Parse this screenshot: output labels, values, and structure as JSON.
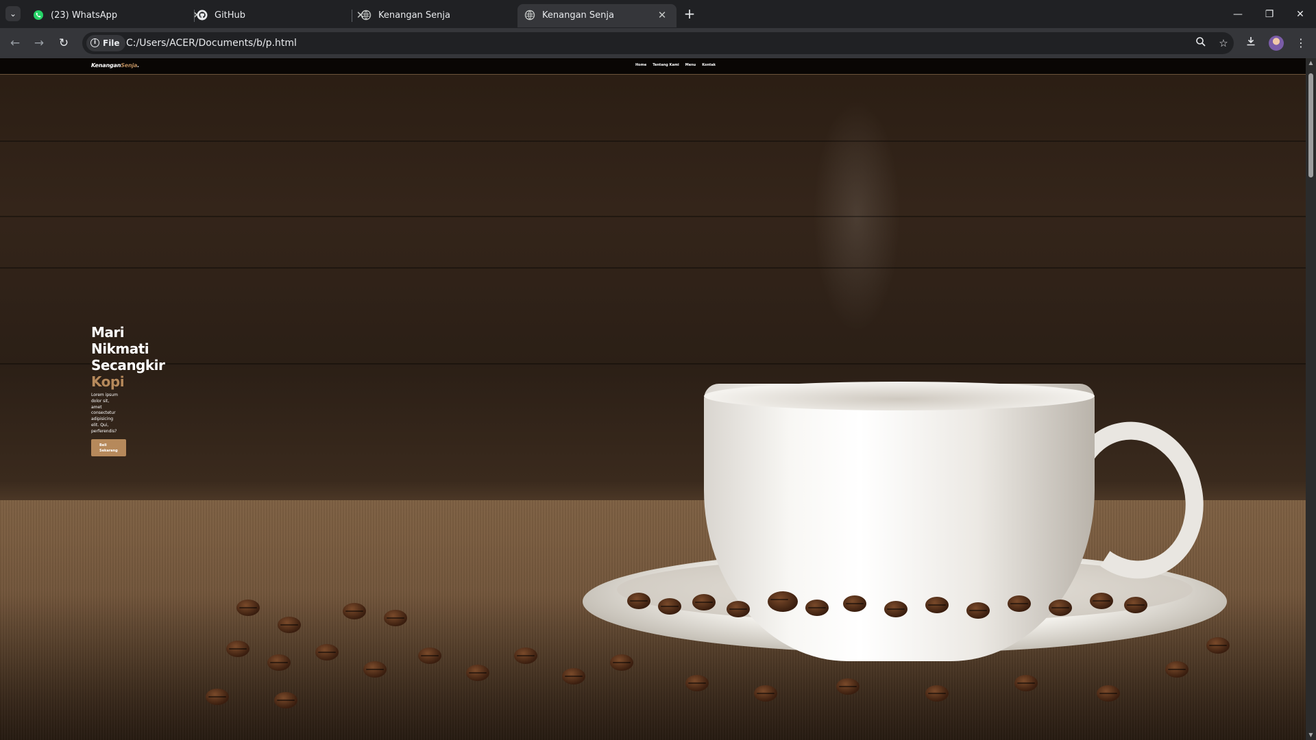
{
  "browser": {
    "tabs": [
      {
        "title": "(23) WhatsApp",
        "icon": "whatsapp-icon",
        "active": false
      },
      {
        "title": "GitHub",
        "icon": "github-icon",
        "active": false
      },
      {
        "title": "Kenangan Senja",
        "icon": "globe-icon",
        "active": false
      },
      {
        "title": "Kenangan Senja",
        "icon": "globe-icon",
        "active": true
      }
    ],
    "new_tab_label": "+",
    "address": {
      "scheme_chip": "File",
      "url": "C:/Users/ACER/Documents/b/p.html"
    },
    "colors": {
      "frame": "#202124",
      "toolbar": "#35363a",
      "text": "#e8eaed"
    }
  },
  "site": {
    "logo": {
      "part1": "Kenangan",
      "part2": "Senja",
      "part3": "."
    },
    "nav": [
      "Home",
      "Tentang Kami",
      "Menu",
      "Kontak"
    ],
    "hero": {
      "line1": "Mari",
      "line2": "Nikmati",
      "line3": "Secangkir",
      "line4": "Kopi",
      "paragraph": "Lorem ipsum dolor sit, amet consectetur adipisicing elit. Qui, perferendis?",
      "cta": "Beli Sekarang"
    },
    "colors": {
      "accent": "#b6895b",
      "text": "#ffffff",
      "nav_bg": "#000000"
    }
  }
}
